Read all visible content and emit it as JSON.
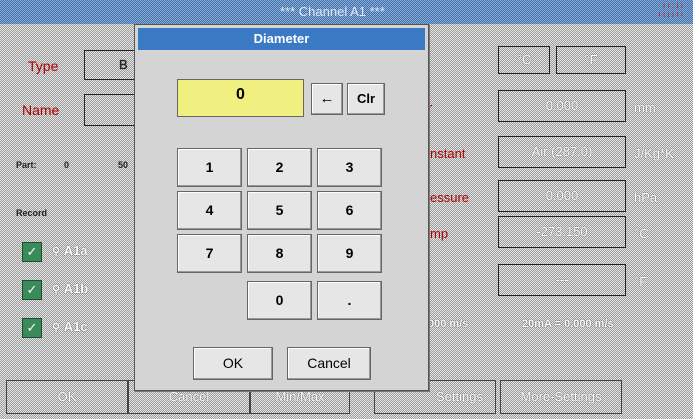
{
  "header": {
    "title": "*** Channel A1 ***",
    "clock_line1": "ı ı : ı ı",
    "clock_line2": "ı ı ı ı ı ı"
  },
  "left_panel": {
    "type_label": "Type",
    "type_value": "B",
    "name_label": "Name",
    "part_label": "Part:",
    "part_value": "0",
    "part_extra": "50",
    "record_label": "Record",
    "records": [
      {
        "check": "✓",
        "label": "A1a"
      },
      {
        "check": "✓",
        "label": "A1b"
      },
      {
        "check": "✓",
        "label": "A1c"
      }
    ]
  },
  "right_panel": {
    "unit_c": "°C",
    "unit_f": "°F",
    "diameter_value": "0.000",
    "diameter_unit": "mm",
    "gas_label_fragment": "nstant",
    "gas_value": "Air (287.0)",
    "gas_unit": "J/Kg*K",
    "pressure_label_fragment": "essure",
    "pressure_value": "0.000",
    "pressure_unit": "hPa",
    "temp_label_fragment": "mp",
    "temp_value": "-273.150",
    "temp_unit": "°C",
    "f_value": "---",
    "f_unit": "°F",
    "scale_left": "000 m/s",
    "scale_right": "20mA = 0.000 m/s"
  },
  "bottom_bar": {
    "ok": "OK",
    "cancel": "Cancel",
    "minmax": "Min/Max",
    "settings": "Settings",
    "more_settings": "More-Settings"
  },
  "dialog": {
    "title": "Diameter",
    "display_value": "0",
    "backspace": "←",
    "clear": "Clr",
    "keys": [
      "1",
      "2",
      "3",
      "4",
      "5",
      "6",
      "7",
      "8",
      "9",
      "0",
      "."
    ],
    "ok": "OK",
    "cancel": "Cancel"
  },
  "colors": {
    "title_blue": "#3a7ac4",
    "display_yellow": "#f0f080",
    "label_red": "#b00000",
    "check_green": "#3a8a5a"
  }
}
